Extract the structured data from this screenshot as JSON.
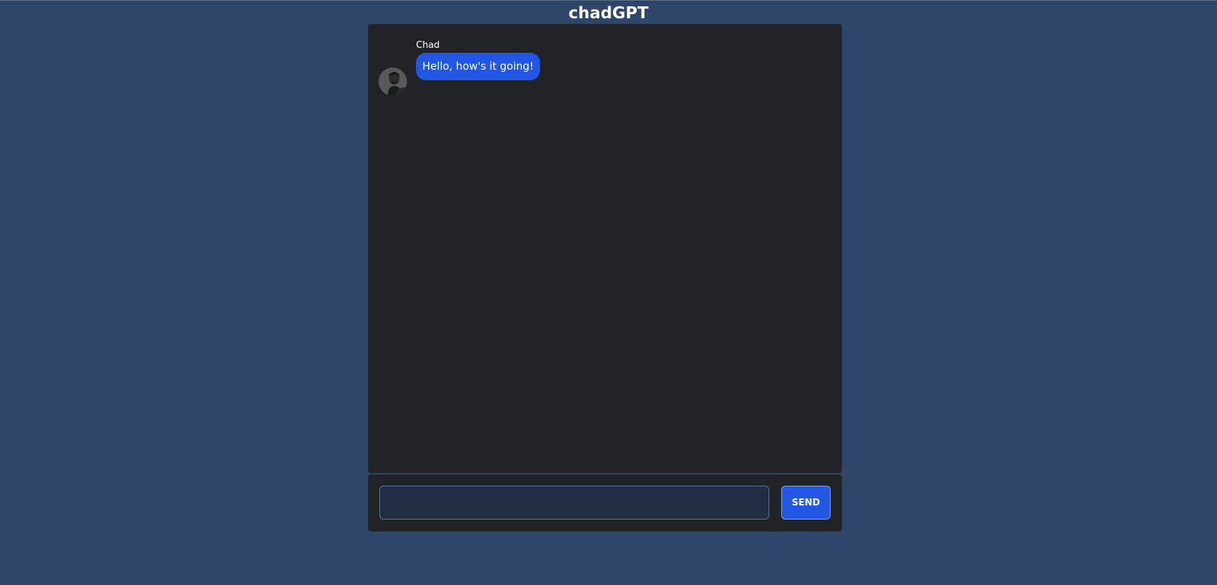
{
  "app": {
    "title": "chadGPT"
  },
  "chat": {
    "messages": [
      {
        "sender": "Chad",
        "text": "Hello, how's it going!",
        "avatar_icon": "user-avatar-photo"
      }
    ]
  },
  "composer": {
    "input_value": "",
    "input_placeholder": "",
    "send_label": "SEND"
  },
  "colors": {
    "page_background": "#2d4669",
    "panel_background": "#222326",
    "accent": "#2257e6",
    "input_background": "#212d43",
    "input_border": "#5a74a3"
  }
}
